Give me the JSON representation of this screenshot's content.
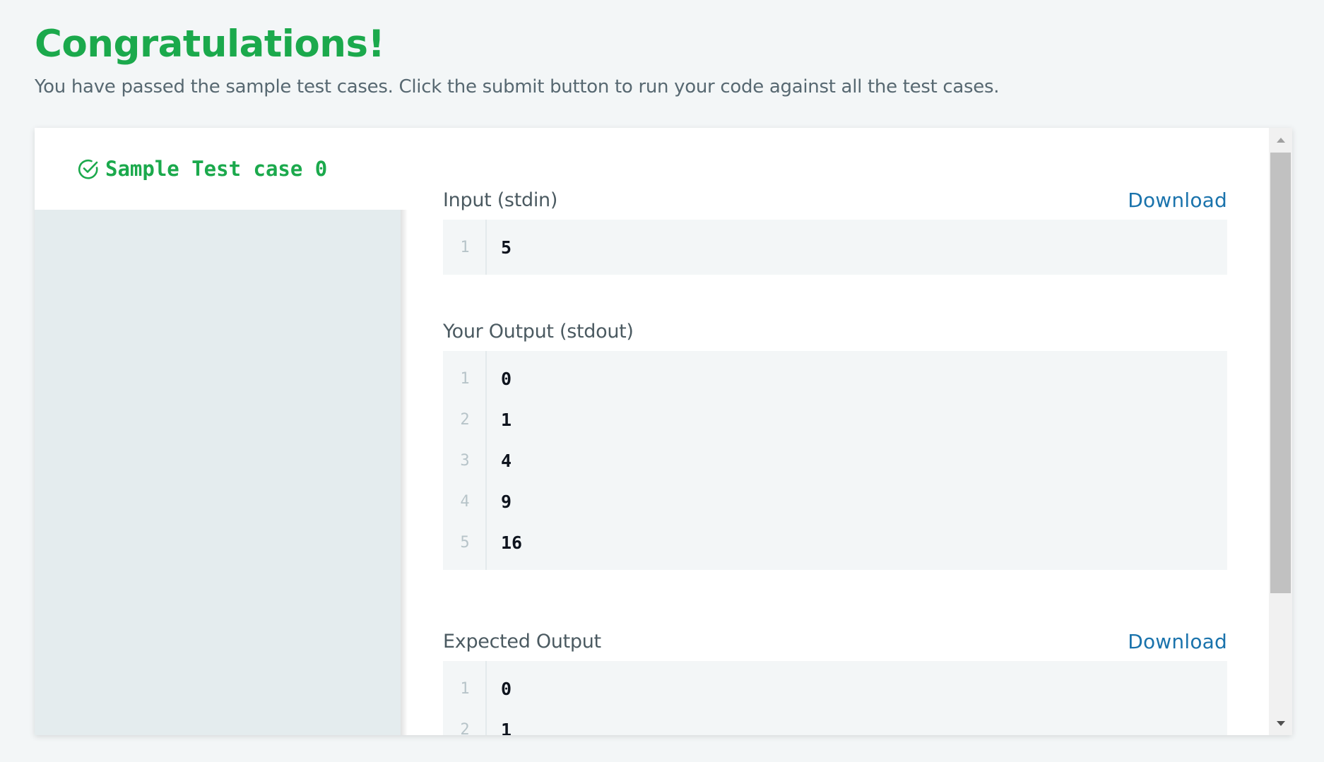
{
  "header": {
    "title": "Congratulations!",
    "subtitle": "You have passed the sample test cases. Click the submit button to run your code against all the test cases."
  },
  "sidebar": {
    "tabs": [
      {
        "label": "Sample Test case 0",
        "status": "passed",
        "icon": "check-circle-icon"
      }
    ]
  },
  "sections": {
    "input": {
      "title": "Input (stdin)",
      "download_label": "Download",
      "lines": [
        {
          "num": "1",
          "text": "5"
        }
      ]
    },
    "your_output": {
      "title": "Your Output (stdout)",
      "lines": [
        {
          "num": "1",
          "text": "0"
        },
        {
          "num": "2",
          "text": "1"
        },
        {
          "num": "3",
          "text": "4"
        },
        {
          "num": "4",
          "text": "9"
        },
        {
          "num": "5",
          "text": "16"
        }
      ]
    },
    "expected_output": {
      "title": "Expected Output",
      "download_label": "Download",
      "lines": [
        {
          "num": "1",
          "text": "0"
        },
        {
          "num": "2",
          "text": "1"
        }
      ]
    }
  },
  "colors": {
    "success": "#1ba94c",
    "link": "#1a73ac",
    "background": "#f3f6f7"
  }
}
